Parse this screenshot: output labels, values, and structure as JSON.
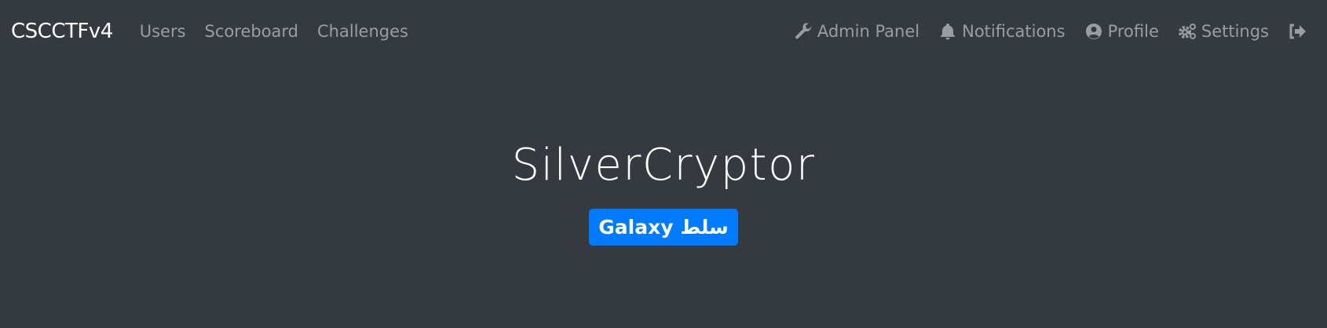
{
  "navbar": {
    "brand": "CSCCTFv4",
    "left_links": [
      "Users",
      "Scoreboard",
      "Challenges"
    ],
    "right_links": [
      {
        "label": "Admin Panel",
        "icon": "wrench-icon"
      },
      {
        "label": "Notifications",
        "icon": "bell-icon"
      },
      {
        "label": "Profile",
        "icon": "user-circle-icon"
      },
      {
        "label": "Settings",
        "icon": "cogs-icon"
      }
    ],
    "logout_icon": "sign-out-icon"
  },
  "profile": {
    "name": "SilverCryptor",
    "badge": "Galaxy سلط",
    "badge_color": "#007bff"
  },
  "colors": {
    "background": "#343a40",
    "nav_link": "#9a9da0"
  }
}
